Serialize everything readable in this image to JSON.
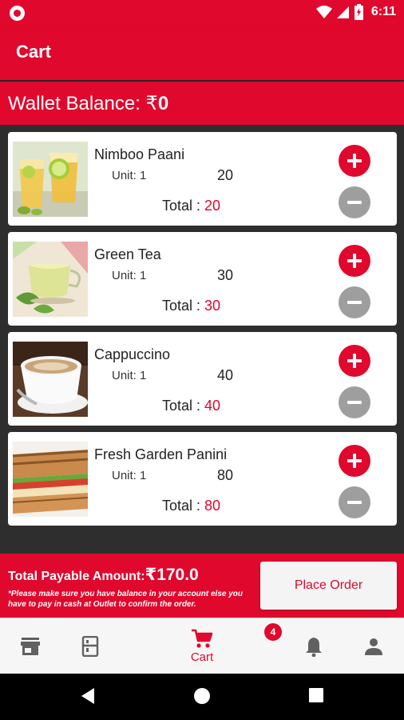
{
  "status_bar": {
    "time": "6:11"
  },
  "app_bar": {
    "title": "Cart"
  },
  "wallet": {
    "label": "Wallet Balance: ",
    "currency": "₹",
    "value": "0"
  },
  "items": [
    {
      "name": "Nimboo Paani",
      "unit": "Unit: 1",
      "price": "20",
      "total_label": "Total : ",
      "total": "20"
    },
    {
      "name": "Green Tea",
      "unit": "Unit: 1",
      "price": "30",
      "total_label": "Total : ",
      "total": "30"
    },
    {
      "name": "Cappuccino",
      "unit": "Unit: 1",
      "price": "40",
      "total_label": "Total : ",
      "total": "40"
    },
    {
      "name": "Fresh Garden Panini",
      "unit": "Unit: 1",
      "price": "80",
      "total_label": "Total : ",
      "total": "80"
    }
  ],
  "footer": {
    "payable_label": "Total Payable Amount:",
    "payable_amount": "₹170.0",
    "note": "*Please make sure you have balance in your account else you have to pay in cash at Outlet to confirm the order.",
    "place_order": "Place Order"
  },
  "bottom_nav": {
    "cart_label": "Cart",
    "notification_count": "4",
    "icons": [
      "store-icon",
      "menu-card-icon",
      "cart-icon",
      "bell-icon",
      "person-icon"
    ]
  },
  "colors": {
    "primary": "#e0082d",
    "remove_button": "#9e9e9e",
    "list_background": "#2e2e2e"
  }
}
